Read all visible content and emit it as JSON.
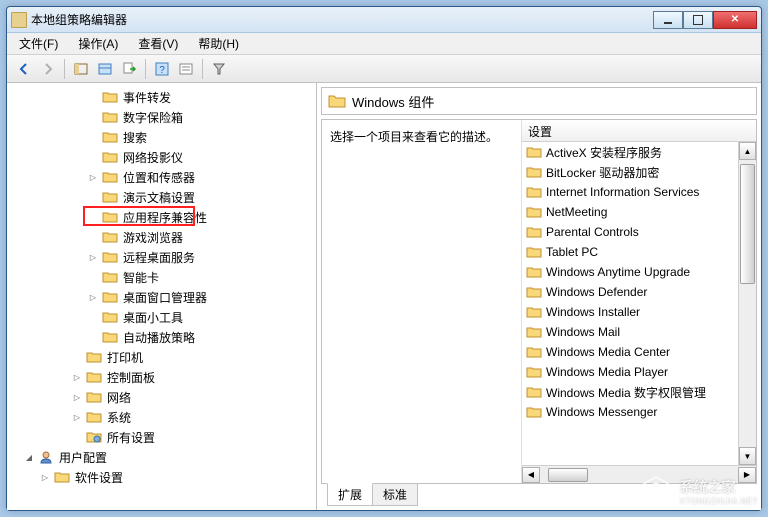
{
  "window": {
    "title": "本地组策略编辑器"
  },
  "menu": {
    "file": "文件(F)",
    "action": "操作(A)",
    "view": "查看(V)",
    "help": "帮助(H)"
  },
  "tree": {
    "items": [
      {
        "indent": 5,
        "label": "事件转发",
        "expander": ""
      },
      {
        "indent": 5,
        "label": "数字保险箱",
        "expander": ""
      },
      {
        "indent": 5,
        "label": "搜索",
        "expander": ""
      },
      {
        "indent": 5,
        "label": "网络投影仪",
        "expander": ""
      },
      {
        "indent": 5,
        "label": "位置和传感器",
        "expander": "▷"
      },
      {
        "indent": 5,
        "label": "演示文稿设置",
        "expander": ""
      },
      {
        "indent": 5,
        "label": "应用程序兼容性",
        "expander": "",
        "highlighted": true
      },
      {
        "indent": 5,
        "label": "游戏浏览器",
        "expander": ""
      },
      {
        "indent": 5,
        "label": "远程桌面服务",
        "expander": "▷"
      },
      {
        "indent": 5,
        "label": "智能卡",
        "expander": ""
      },
      {
        "indent": 5,
        "label": "桌面窗口管理器",
        "expander": "▷"
      },
      {
        "indent": 5,
        "label": "桌面小工具",
        "expander": ""
      },
      {
        "indent": 5,
        "label": "自动播放策略",
        "expander": ""
      },
      {
        "indent": 4,
        "label": "打印机",
        "expander": ""
      },
      {
        "indent": 4,
        "label": "控制面板",
        "expander": "▷"
      },
      {
        "indent": 4,
        "label": "网络",
        "expander": "▷"
      },
      {
        "indent": 4,
        "label": "系统",
        "expander": "▷"
      },
      {
        "indent": 4,
        "label": "所有设置",
        "expander": "",
        "special": "all"
      },
      {
        "indent": 1,
        "label": "用户配置",
        "expander": "◢",
        "special": "user"
      },
      {
        "indent": 2,
        "label": "软件设置",
        "expander": "▷"
      }
    ]
  },
  "header": {
    "title": "Windows 组件"
  },
  "detail": {
    "prompt": "选择一个项目来查看它的描述。",
    "column": "设置",
    "items": [
      "ActiveX 安装程序服务",
      "BitLocker 驱动器加密",
      "Internet Information Services",
      "NetMeeting",
      "Parental Controls",
      "Tablet PC",
      "Windows Anytime Upgrade",
      "Windows Defender",
      "Windows Installer",
      "Windows Mail",
      "Windows Media Center",
      "Windows Media Player",
      "Windows Media 数字权限管理",
      "Windows Messenger"
    ]
  },
  "tabs": {
    "extended": "扩展",
    "standard": "标准"
  },
  "watermark": {
    "text": "系统之家",
    "url": "XTONGZHIJIA.NET"
  }
}
